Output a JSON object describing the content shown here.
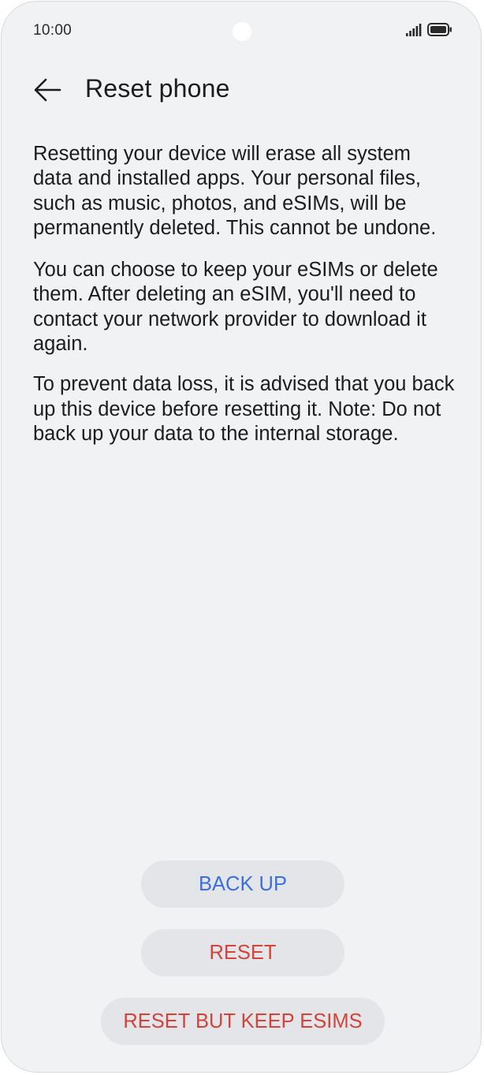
{
  "status_bar": {
    "time": "10:00",
    "signal_icon": "signal-bars-icon",
    "battery_icon": "battery-icon"
  },
  "header": {
    "back_icon": "arrow-left-icon",
    "title": "Reset phone"
  },
  "body": {
    "paragraphs": [
      "Resetting your device will erase all system data and installed apps. Your personal files, such as music, photos, and eSIMs, will be permanently deleted. This cannot be undone.",
      "You can choose to keep your eSIMs or delete them. After deleting an eSIM, you'll need to contact your network provider to download it again.",
      "To prevent data loss, it is advised that you back up this device before resetting it. Note: Do not back up your data to the internal storage."
    ]
  },
  "actions": {
    "backup_label": "BACK UP",
    "reset_label": "RESET",
    "reset_keep_esims_label": "RESET BUT KEEP ESIMS"
  },
  "colors": {
    "background": "#f1f2f4",
    "button_background": "#e4e5e8",
    "primary_blue": "#3b6fe0",
    "destructive_red": "#d2433a"
  }
}
